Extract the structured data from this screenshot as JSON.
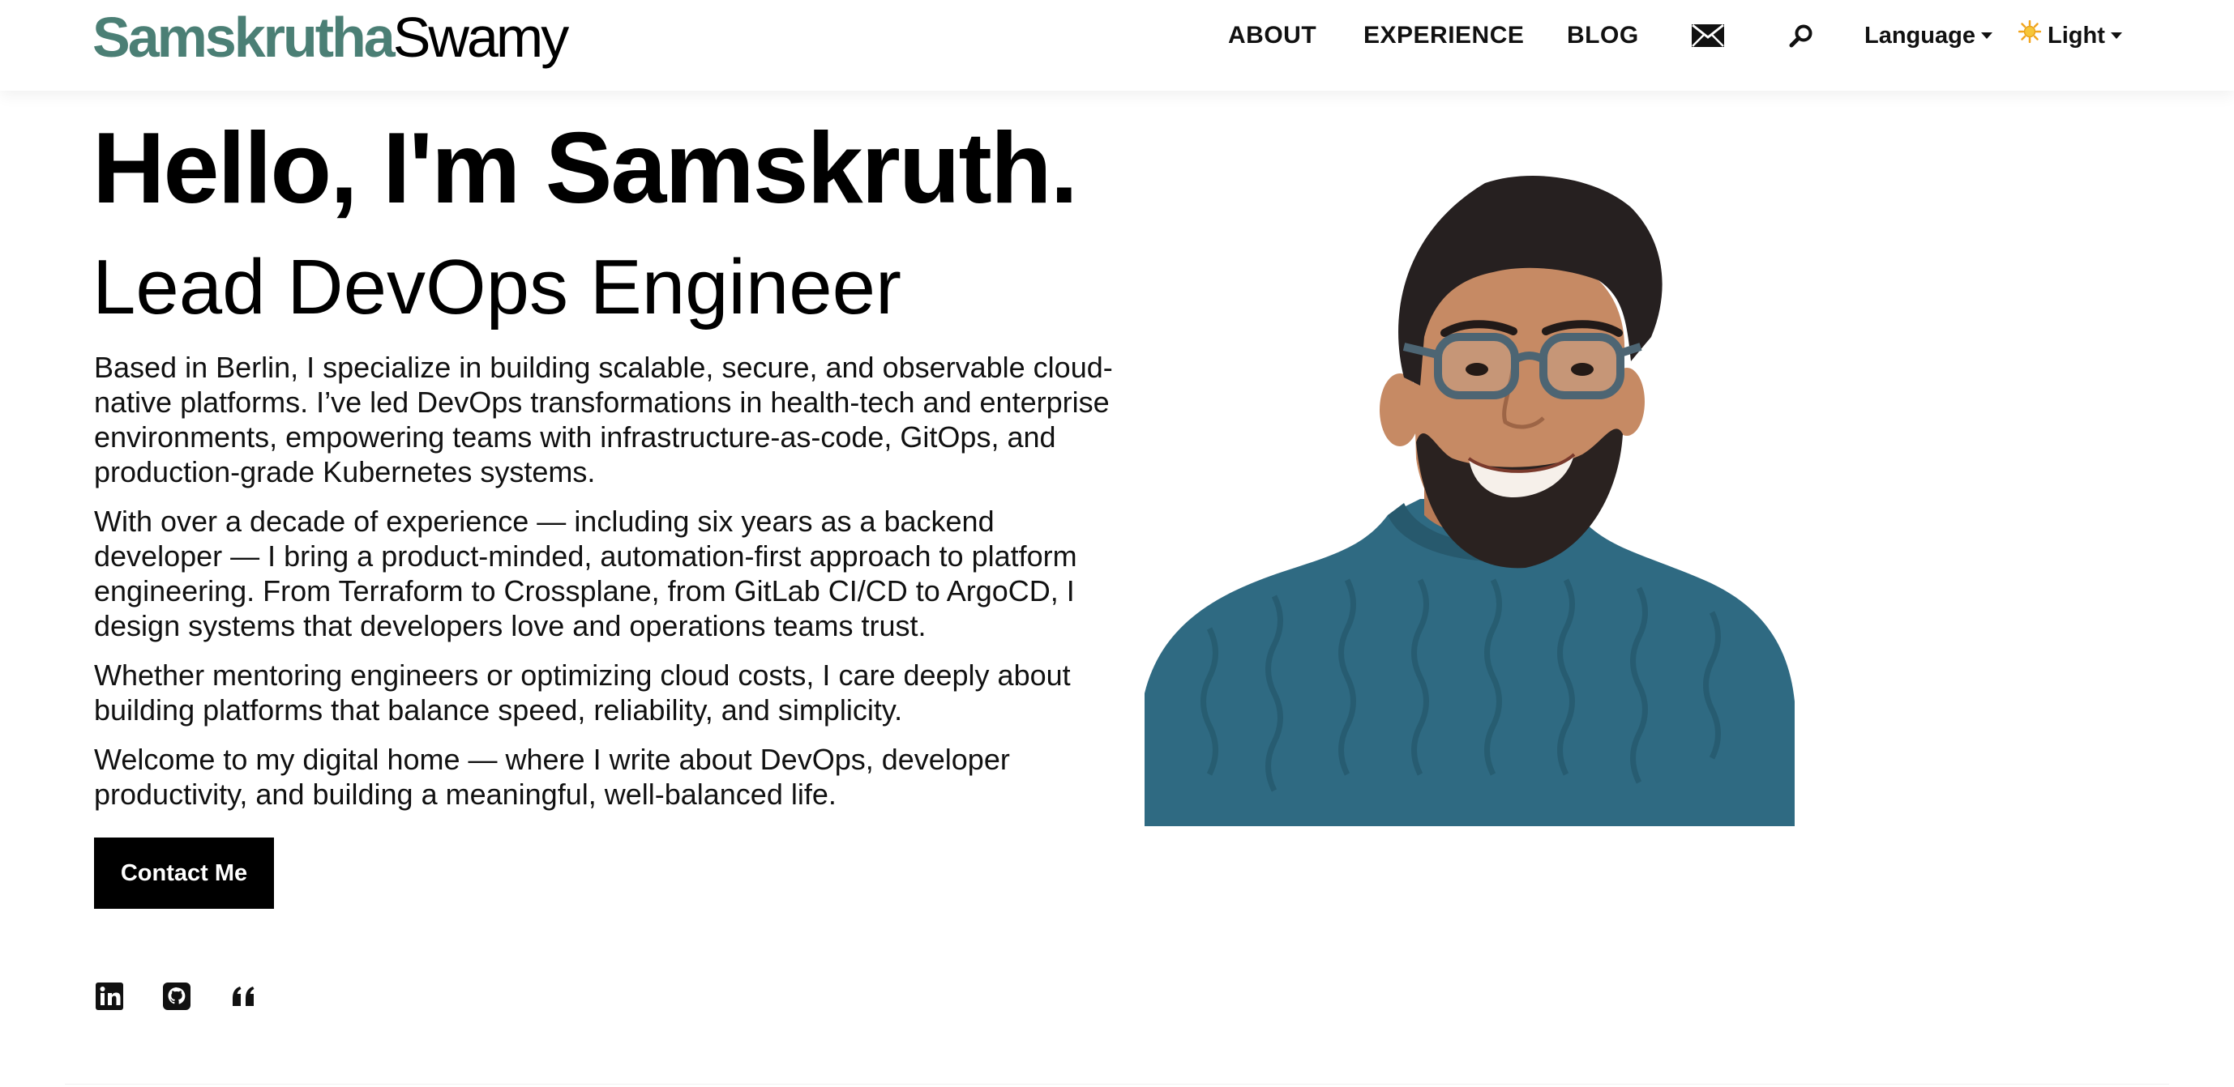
{
  "header": {
    "brand_first": "Samskrutha",
    "brand_last": "Swamy",
    "nav": {
      "about": "ABOUT",
      "experience": "EXPERIENCE",
      "blog": "BLOG"
    },
    "language_label": "Language",
    "theme_label": "Light"
  },
  "hero": {
    "title": "Hello, I'm Samskruth.",
    "subtitle": "Lead DevOps Engineer",
    "paragraphs": [
      "Based in Berlin, I specialize in building scalable, secure, and observable cloud-native platforms. I’ve led DevOps transformations in health-tech and enterprise environments, empowering teams with infrastructure-as-code, GitOps, and production-grade Kubernetes systems.",
      "With over a decade of experience — including six years as a backend developer — I bring a product-minded, automation-first approach to platform engineering. From Terraform to Crossplane, from GitLab CI/CD to ArgoCD, I design systems that developers love and operations teams trust.",
      "Whether mentoring engineers or optimizing cloud costs, I care deeply about building platforms that balance speed, reliability, and simplicity.",
      "Welcome to my digital home — where I write about DevOps, developer productivity, and building a meaningful, well-balanced life."
    ],
    "contact_button": "Contact Me"
  },
  "social_icons": [
    "linkedin-icon",
    "github-icon",
    "quote-icon"
  ],
  "colors": {
    "brand_accent": "#4b7f75",
    "button_bg": "#000000",
    "sweater": "#2f6a82",
    "hair": "#262020",
    "skin": "#c68a64"
  }
}
